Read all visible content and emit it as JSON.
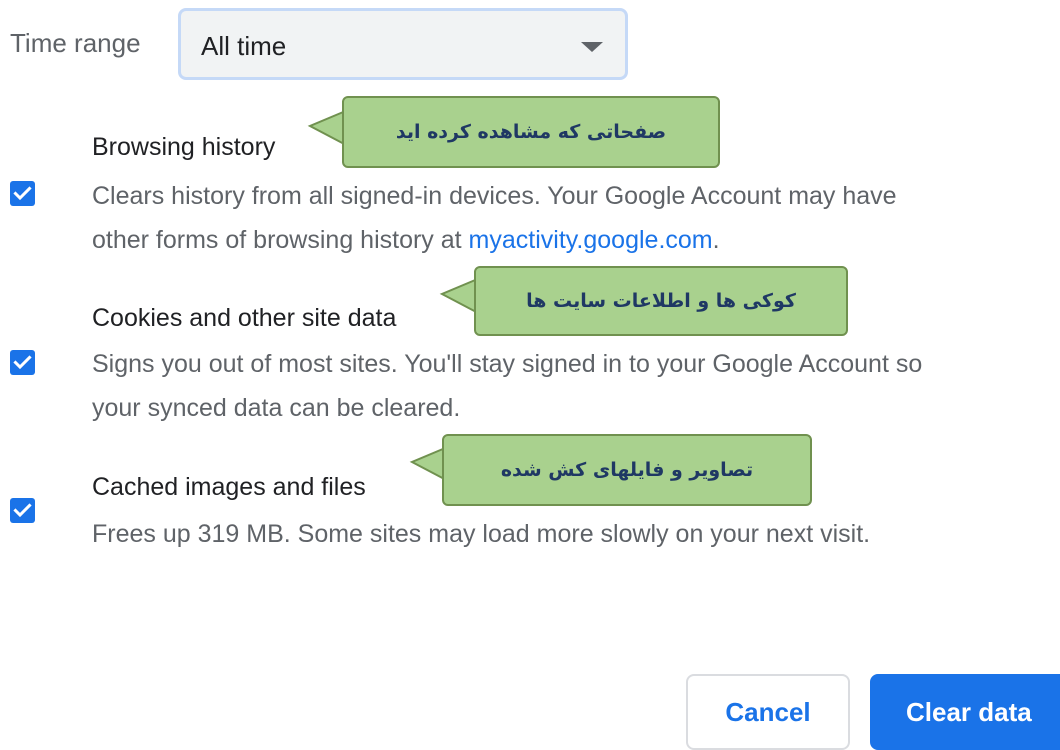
{
  "time_range": {
    "label": "Time range",
    "selected": "All time"
  },
  "items": [
    {
      "title": "Browsing history",
      "checked": true,
      "desc_line1": "Clears history from all signed-in devices. Your Google Account may have",
      "desc_line2_prefix": "other forms of browsing history at ",
      "desc_link": "myactivity.google.com",
      "desc_line2_suffix": "."
    },
    {
      "title": "Cookies and other site data",
      "checked": true,
      "desc_line1": "Signs you out of most sites. You'll stay signed in to your Google Account so",
      "desc_line2": "your synced data can be cleared."
    },
    {
      "title": "Cached images and files",
      "checked": true,
      "desc_line1": "Frees up 319 MB. Some sites may load more slowly on your next visit."
    }
  ],
  "callouts": [
    "صفحاتی که مشاهده کرده اید",
    "کوکی ها و اطلاعات سایت ها",
    "تصاویر و فایلهای کش شده"
  ],
  "buttons": {
    "cancel": "Cancel",
    "clear": "Clear data"
  },
  "colors": {
    "accent": "#1a73e8",
    "callout_fill": "#a9d18e",
    "callout_border": "#70914f",
    "callout_text": "#1f3864"
  }
}
